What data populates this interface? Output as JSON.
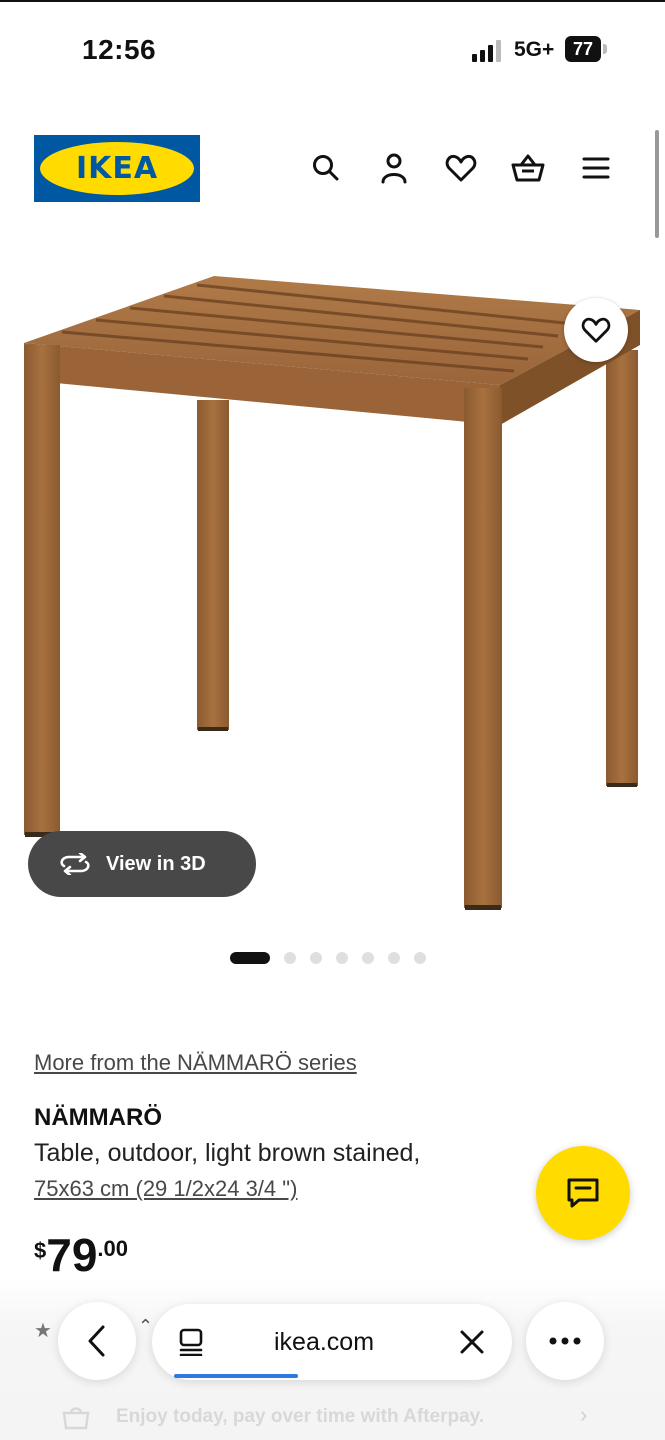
{
  "status_bar": {
    "time": "12:56",
    "network": "5G+",
    "battery": "77"
  },
  "header": {
    "logo_text": "IKEA",
    "icons": [
      "search-icon",
      "account-icon",
      "heart-icon",
      "basket-icon",
      "menu-icon"
    ]
  },
  "gallery": {
    "view_3d_label": "View in 3D",
    "dot_count": 7,
    "active_dot": 0
  },
  "product": {
    "series_link": "More from the NÄMMARÖ series",
    "name": "NÄMMARÖ",
    "description": "Table, outdoor, light brown stained,",
    "size": "75x63 cm (29 1/2x24 3/4 \")",
    "price_currency": "$",
    "price_integer": "79",
    "price_decimal": ".00"
  },
  "browser": {
    "url": "ikea.com",
    "afterpay_text": "Enjoy today, pay over time with Afterpay."
  },
  "colors": {
    "ikea_blue": "#0058a3",
    "ikea_yellow": "#ffdb00",
    "pill_dark": "#484848",
    "link_blue": "#2b7ae0"
  }
}
